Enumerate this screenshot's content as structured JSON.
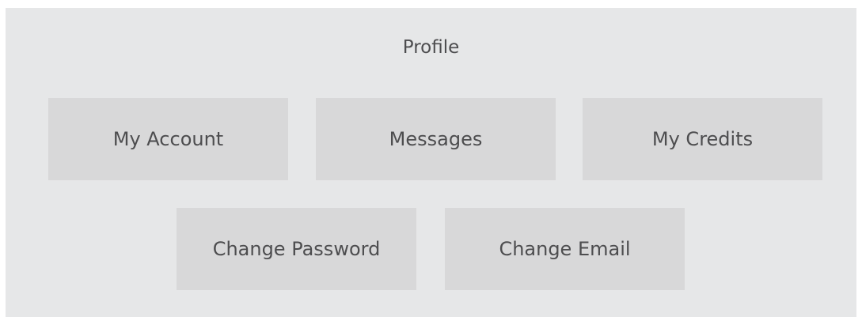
{
  "profile": {
    "title": "Profile",
    "menu": [
      {
        "label": "My Account"
      },
      {
        "label": "Messages"
      },
      {
        "label": "My Credits"
      },
      {
        "label": "Change Password"
      },
      {
        "label": "Change Email"
      }
    ]
  },
  "colors": {
    "panel_background": "#e6e7e8",
    "tile_background": "#d8d8d9",
    "text": "#4d4d4f"
  }
}
